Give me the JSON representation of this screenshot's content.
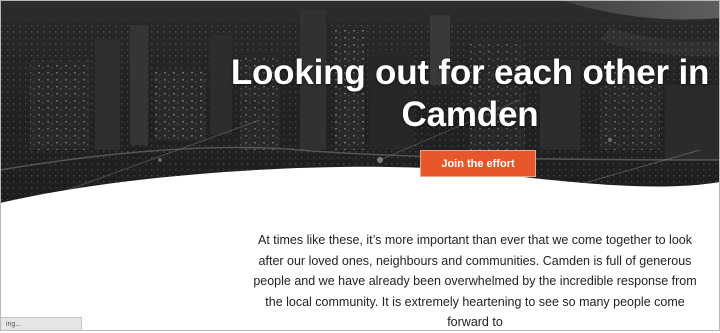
{
  "hero": {
    "top_crumb": "······ ···· ····",
    "title": "Looking out for each other in Camden",
    "cta_label": "Join the effort"
  },
  "intro": {
    "text": "At times like these, it’s more important than ever that we come together to look after our loved ones, neighbours and communities. Camden is full of generous people and we have already been overwhelmed by the incredible response from the local community. It is extremely heartening to see so many people come forward to"
  },
  "status_bar": {
    "text": "ing..."
  },
  "colors": {
    "accent": "#e8572b",
    "hero_overlay": "#2b2b2b",
    "body_text": "#222222",
    "background": "#ffffff"
  }
}
